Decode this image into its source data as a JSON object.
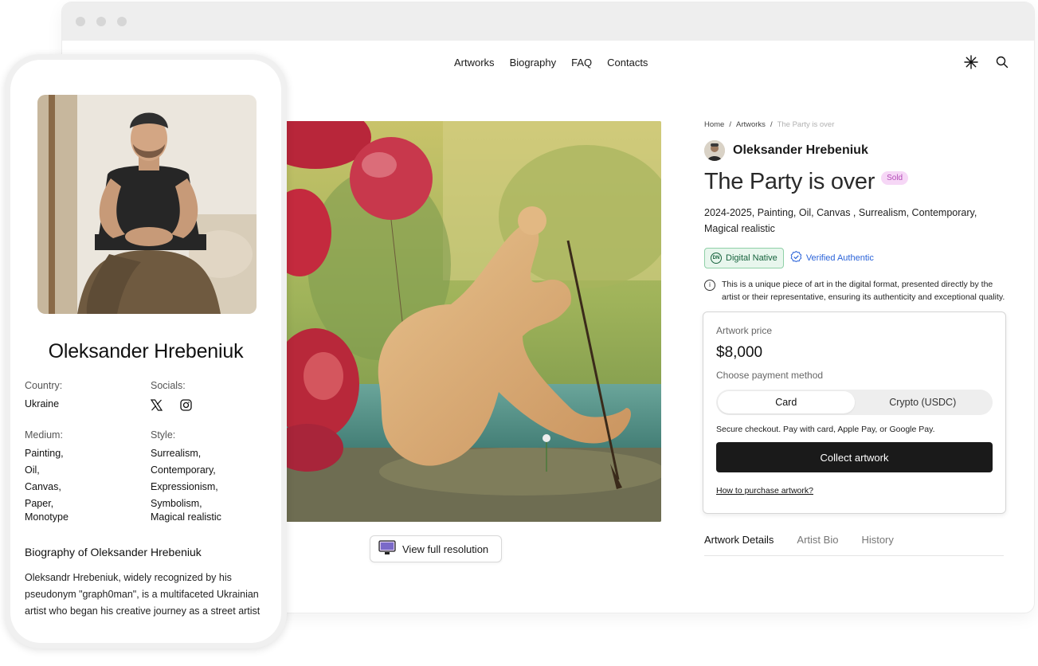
{
  "nav": {
    "links": [
      "Artworks",
      "Biography",
      "FAQ",
      "Contacts"
    ]
  },
  "breadcrumb": {
    "home": "Home",
    "sep": "/",
    "section": "Artworks",
    "current": "The Party is over"
  },
  "artist": {
    "name": "Oleksander Hrebeniuk"
  },
  "artwork": {
    "title": "The Party is over",
    "status": "Sold",
    "meta": "2024-2025, Painting, Oil, Canvas , Surrealism, Contemporary, Magical realistic",
    "view_full_label": "View full resolution"
  },
  "badges": {
    "digital_native": "Digital Native",
    "dn_abbr": "DN",
    "verified": "Verified Authentic"
  },
  "notice": "This is a unique piece of art in the digital format, presented directly by the artist or their representative, ensuring its authenticity and exceptional quality.",
  "purchase": {
    "price_label": "Artwork price",
    "price": "$8,000",
    "payment_label": "Choose payment method",
    "methods": [
      "Card",
      "Crypto (USDC)"
    ],
    "selected_method": "Card",
    "secure_text": "Secure checkout. Pay with card, Apple Pay, or Google Pay.",
    "collect_label": "Collect artwork",
    "how_link": "How to purchase artwork?"
  },
  "tabs": [
    "Artwork Details",
    "Artist Bio",
    "History"
  ],
  "mobile": {
    "name": "Oleksander Hrebeniuk",
    "country_label": "Country:",
    "country": "Ukraine",
    "socials_label": "Socials:",
    "medium_label": "Medium:",
    "medium": [
      "Painting,",
      "Oil,",
      "Canvas,",
      "Paper,",
      "Monotype"
    ],
    "style_label": "Style:",
    "style": [
      "Surrealism,",
      "Contemporary,",
      "Expressionism,",
      "Symbolism,",
      "Magical realistic"
    ],
    "bio_heading": "Biography of Oleksander Hrebeniuk",
    "bio_text": "Oleksandr Hrebeniuk, widely recognized by his pseudonym \"graph0man\", is a multifaceted Ukrainian artist who began his creative journey as a street artist"
  },
  "colors": {
    "sold_bg": "#f6d7f6",
    "sold_text": "#b34bb7",
    "digital_native": "#16633d",
    "verified": "#2b63d9",
    "button": "#1a1a1a"
  },
  "icons": [
    "sparkle-icon",
    "search-icon",
    "x-social-icon",
    "instagram-icon",
    "monitor-icon",
    "info-icon",
    "verified-badge-icon"
  ]
}
